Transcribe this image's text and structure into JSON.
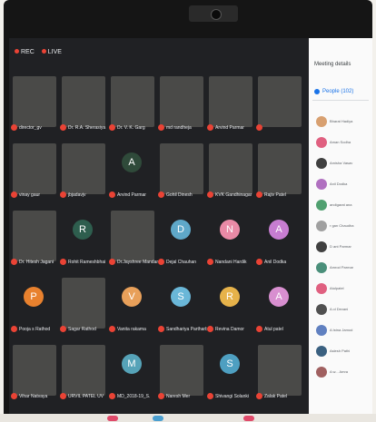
{
  "meeting": {
    "rec_label": "REC",
    "live_label": "LIVE"
  },
  "panel": {
    "title": "Meeting details",
    "people_tab": "People (102)",
    "people_list": [
      "Bharat Hadiya",
      "Aman Sodha",
      "Amisha Vasav",
      "Anil Dodka",
      "andigarat ana",
      "r gan Chaudha",
      "D ant Parmar",
      "Amrod Parmar",
      "Atulpatel",
      "A ol Devani",
      "A Istna Jamod",
      "Aslesh Pathi",
      "A w... Amra"
    ]
  },
  "participants": [
    {
      "name": "director_gv",
      "type": "video"
    },
    {
      "name": "Dr. R.A. Sherasiya",
      "type": "video"
    },
    {
      "name": "Dr. V. K. Garg",
      "type": "video"
    },
    {
      "name": "md randheja",
      "type": "video"
    },
    {
      "name": "Arvind Parmar",
      "type": "video"
    },
    {
      "name": "",
      "type": "video"
    },
    {
      "name": "vinay gaur",
      "type": "video"
    },
    {
      "name": "jbjadavjv",
      "type": "video"
    },
    {
      "name": "Arvind Parmar",
      "type": "avatar",
      "letter": "A",
      "color": "#2f4a3a"
    },
    {
      "name": "Gohil Dinesh",
      "type": "video"
    },
    {
      "name": "KVK Gandhinagar",
      "type": "video"
    },
    {
      "name": "Rajiv Patel",
      "type": "video"
    },
    {
      "name": "Dr. Hitesh Jagani",
      "type": "video"
    },
    {
      "name": "Rohit Rameshbhai",
      "type": "avatar",
      "letter": "R",
      "color": "#2e5e4e"
    },
    {
      "name": "Dr.Jayshree Mandan",
      "type": "video"
    },
    {
      "name": "Dejal Chauhan",
      "type": "avatar",
      "letter": "D",
      "color": "#5fa8c9"
    },
    {
      "name": "Nandani Hardik",
      "type": "avatar",
      "letter": "N",
      "color": "#e98aa6"
    },
    {
      "name": "Anil Dodka",
      "type": "avatar",
      "letter": "A",
      "color": "#c77dd1"
    },
    {
      "name": "Pooja s Rathod",
      "type": "avatar",
      "letter": "P",
      "color": "#e8812e"
    },
    {
      "name": "Sagar Rathod",
      "type": "video"
    },
    {
      "name": "Vanita rakama",
      "type": "avatar",
      "letter": "V",
      "color": "#e8a05a"
    },
    {
      "name": "Sandhariya Partharbhi",
      "type": "avatar",
      "letter": "S",
      "color": "#6ab7d8"
    },
    {
      "name": "Revina Damor",
      "type": "avatar",
      "letter": "R",
      "color": "#e6b24a"
    },
    {
      "name": "Atul patel",
      "type": "avatar",
      "letter": "A",
      "color": "#d88fd0"
    },
    {
      "name": "Vihar Natvaya",
      "type": "video"
    },
    {
      "name": "URVIL PATEL UV",
      "type": "video"
    },
    {
      "name": "MD_2018-19_S.",
      "type": "avatar",
      "letter": "M",
      "color": "#56a3b8"
    },
    {
      "name": "Naresh Mer",
      "type": "video"
    },
    {
      "name": "Shivangi Solanki",
      "type": "avatar",
      "letter": "S",
      "color": "#4e9fc1"
    },
    {
      "name": "Zalak Patel",
      "type": "video"
    }
  ]
}
